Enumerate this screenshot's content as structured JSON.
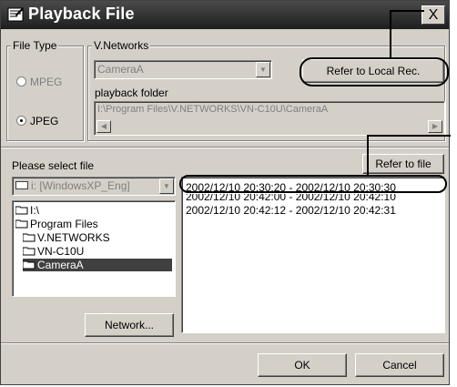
{
  "window": {
    "title": "Playback File",
    "close_glyph": "X"
  },
  "file_type": {
    "group_title": "File Type",
    "options": [
      {
        "label": "MPEG",
        "selected": false,
        "enabled": false
      },
      {
        "label": "JPEG",
        "selected": true,
        "enabled": true
      }
    ]
  },
  "networks": {
    "group_title": "V.Networks",
    "camera_value": "CameraA",
    "refer_local_label": "Refer to Local Rec.",
    "folder_label": "playback folder",
    "folder_value": "I:\\Program Files\\V.NETWORKS\\VN-C10U\\CameraA"
  },
  "selection": {
    "prompt": "Please select file",
    "refer_file_label": "Refer to file",
    "drive_value": "i: [WindowsXP_Eng]",
    "files": [
      "2002/12/10 20:30:20 - 2002/12/10 20:30:30",
      "2002/12/10 20:42:00 - 2002/12/10 20:42:10",
      "2002/12/10 20:42:12 - 2002/12/10 20:42:31"
    ],
    "tree": [
      "I:\\",
      "Program Files",
      "V.NETWORKS",
      "VN-C10U",
      "CameraA"
    ]
  },
  "buttons": {
    "network": "Network...",
    "ok": "OK",
    "cancel": "Cancel"
  },
  "colors": {
    "face": "#d4d0c8",
    "titlebar": "#2a2a2a",
    "selected": "#404040"
  }
}
